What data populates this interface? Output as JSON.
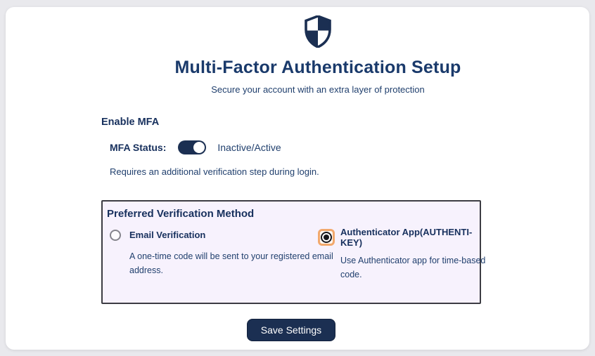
{
  "header": {
    "icon": "shield-icon",
    "title": "Multi-Factor Authentication Setup",
    "subtitle": "Secure your account with an extra layer of protection"
  },
  "enable_mfa": {
    "section_label": "Enable MFA",
    "status_label": "MFA Status:",
    "toggle": {
      "state": "on",
      "color": "#1b2f52"
    },
    "status_value": "Inactive/Active",
    "description": "Requires an additional verification step during login."
  },
  "verification": {
    "heading": "Preferred Verification Method",
    "options": [
      {
        "label": "Email Verification",
        "description": "A one-time code will be sent to your registered email address.",
        "selected": false
      },
      {
        "label": "Authenticator App(AUTHENTI-KEY)",
        "description": "Use Authenticator app for time-based code.",
        "selected": true
      }
    ]
  },
  "actions": {
    "save_label": "Save Settings"
  },
  "colors": {
    "page_background": "#e9e9ed",
    "card_background": "#ffffff",
    "navy": "#1b2f52",
    "text_navy": "#21406e",
    "box_background": "#f7f2fd",
    "box_border": "#3c3c43",
    "selection_highlight": "#f2a96d"
  }
}
